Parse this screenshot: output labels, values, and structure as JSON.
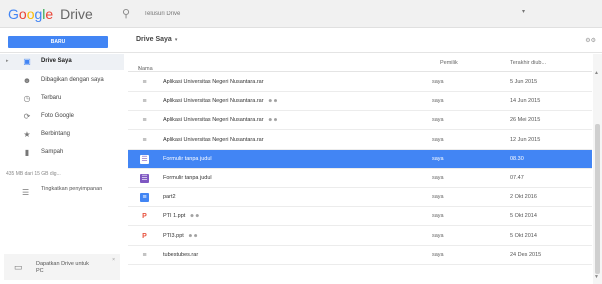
{
  "header": {
    "logo_letters": [
      "G",
      "o",
      "o",
      "g",
      "l",
      "e"
    ],
    "logo_product": "Drive",
    "search_placeholder": "Telusuri Drive",
    "search_dropdown": "▾"
  },
  "toolbar": {
    "new_label": "BARU",
    "breadcrumb": "Drive Saya",
    "breadcrumb_caret": "▾",
    "view_icon": "settings-icon"
  },
  "sidebar": {
    "items": [
      {
        "label": "Drive Saya",
        "icon": "drive-icon",
        "active": true
      },
      {
        "label": "Dibagikan dengan saya",
        "icon": "people-icon"
      },
      {
        "label": "Terbaru",
        "icon": "clock-icon"
      },
      {
        "label": "Foto Google",
        "icon": "photos-icon"
      },
      {
        "label": "Berbintang",
        "icon": "star-icon"
      },
      {
        "label": "Sampah",
        "icon": "trash-icon"
      }
    ],
    "storage_text": "435 MB dari 15 GB dig...",
    "upgrade_label": "Tingkatkan penyimpanan",
    "get_drive_label": "Dapatkan Drive untuk PC"
  },
  "list": {
    "columns": {
      "name": "Nama",
      "name_sort": "↑",
      "owner": "Pemilik",
      "modified": "Terakhir diub..."
    },
    "rows": [
      {
        "name": "Aplikasi Universitas Negeri Nusantara.rar",
        "type": "rar",
        "shared": false,
        "owner": "saya",
        "date": "5 Jun 2015"
      },
      {
        "name": "Aplikasi Universitas Negeri Nusantara.rar",
        "type": "rar",
        "shared": true,
        "owner": "saya",
        "date": "14 Jun 2015"
      },
      {
        "name": "Aplikasi Universitas Negeri Nusantara.rar",
        "type": "rar",
        "shared": true,
        "owner": "saya",
        "date": "26 Mei 2015"
      },
      {
        "name": "Aplikasi Universitas Negeri Nusantara.rar",
        "type": "rar",
        "shared": false,
        "owner": "saya",
        "date": "12 Jun 2015"
      },
      {
        "name": "Formulir tanpa judul",
        "type": "form",
        "shared": false,
        "owner": "saya",
        "date": "08.30",
        "selected": true
      },
      {
        "name": "Formulir tanpa judul",
        "type": "form",
        "shared": false,
        "owner": "saya",
        "date": "07.47"
      },
      {
        "name": "part2",
        "type": "doc",
        "shared": false,
        "owner": "saya",
        "date": "2 Okt 2016"
      },
      {
        "name": "PTI 1.ppt",
        "type": "ppt",
        "shared": true,
        "owner": "saya",
        "date": "5 Okt 2014"
      },
      {
        "name": "PTI3.ppt",
        "type": "ppt",
        "shared": true,
        "owner": "saya",
        "date": "5 Okt 2014"
      },
      {
        "name": "tubestubes.rar",
        "type": "rar",
        "shared": false,
        "owner": "saya",
        "date": "24 Des 2015"
      }
    ]
  },
  "colors": {
    "accent": "#4285f4",
    "form": "#7e57c2",
    "ppt": "#e8533f"
  }
}
